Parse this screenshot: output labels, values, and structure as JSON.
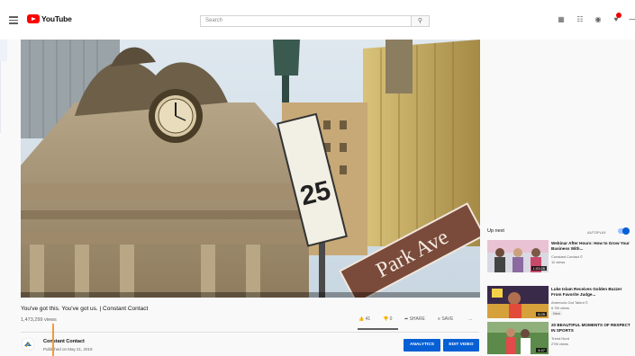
{
  "header": {
    "logo_text": "YouTube",
    "search_placeholder": "Search",
    "icons": [
      "menu-icon",
      "create-video-icon",
      "apps-grid-icon",
      "messages-icon",
      "notifications-icon"
    ]
  },
  "video": {
    "scene": "Grand Central Terminal facade with clock and statues; street signs 25 and Park Ave",
    "sign_number": "25",
    "sign_text": "Park Ave"
  },
  "video_info": {
    "title": "You've got this. You've got us. | Constant Contact",
    "views": "1,473,299 views",
    "like_count": "41",
    "dislike_count": "0",
    "share_label": "SHARE",
    "save_label": "SAVE",
    "more_label": "..."
  },
  "channel": {
    "name": "Constant Contact",
    "published": "Published on May 21, 2019",
    "analytics_label": "ANALYTICS",
    "edit_label": "EDIT VIDEO"
  },
  "sidebar": {
    "up_next": "Up next",
    "autoplay": "AUTOPLAY",
    "items": [
      {
        "title": "Webinar After Hours: How to Grow Your Business With...",
        "channel": "Constant Contact ©",
        "meta": "11 views",
        "duration": "1:03:26"
      },
      {
        "title": "Luke Islam Receives Golden Buzzer From Favorite Judge...",
        "channel": "America's Got Talent ©",
        "meta": "6.7M views",
        "extra": "New",
        "duration": "6:25"
      },
      {
        "title": "20 BEAUTIFUL MOMENTS OF RESPECT IN SPORTS",
        "channel": "Trend Hunt",
        "meta": "27M views",
        "duration": "4:47"
      }
    ]
  },
  "colors": {
    "brand_red": "#ff0000",
    "button_blue": "#065fd4",
    "annotation": "#f29a38"
  }
}
